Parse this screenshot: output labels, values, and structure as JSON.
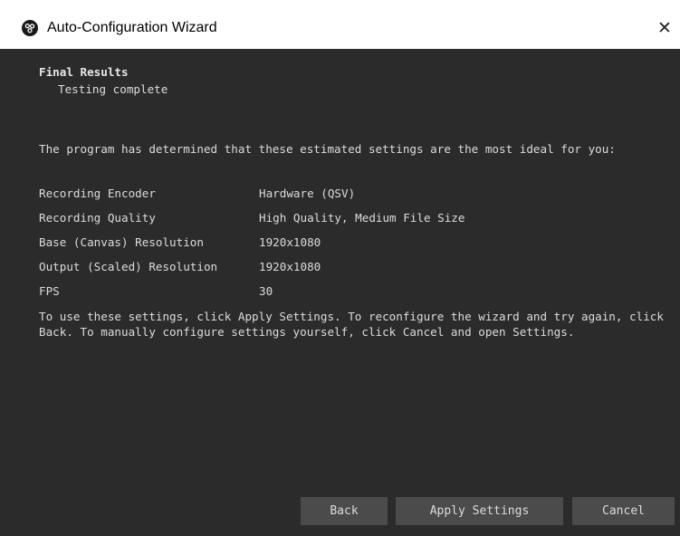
{
  "window": {
    "title": "Auto-Configuration Wizard",
    "close_glyph": "✕",
    "icon": "obs-logo-icon"
  },
  "results": {
    "heading": "Final Results",
    "subheading": "Testing complete",
    "intro": "The program has determined that these estimated settings are the most ideal for you:",
    "rows": [
      {
        "label": "Recording Encoder",
        "value": "Hardware (QSV)"
      },
      {
        "label": "Recording Quality",
        "value": "High Quality, Medium File Size"
      },
      {
        "label": "Base (Canvas) Resolution",
        "value": "1920x1080"
      },
      {
        "label": "Output (Scaled) Resolution",
        "value": "1920x1080"
      },
      {
        "label": "FPS",
        "value": "30"
      }
    ],
    "outro": "To use these settings, click Apply Settings. To reconfigure the wizard and try again, click Back. To manually configure settings yourself, click Cancel and open Settings."
  },
  "buttons": {
    "back": "Back",
    "apply": "Apply Settings",
    "cancel": "Cancel"
  },
  "colors": {
    "background": "#2b2b2b",
    "text": "#dcdcdc",
    "button": "#4b4b4b",
    "titlebar": "#ffffff"
  }
}
